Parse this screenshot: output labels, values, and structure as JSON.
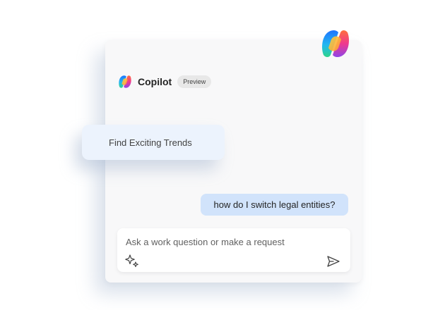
{
  "header": {
    "title": "Copilot",
    "badge": "Preview",
    "logo_icon": "copilot-logo-icon"
  },
  "suggestion": {
    "label": "Find Exciting Trends"
  },
  "conversation": {
    "user_message": "how do I switch legal entities?"
  },
  "composer": {
    "placeholder": "Ask a work question or make a request",
    "value": "",
    "left_icon": "sparkle-icon",
    "right_icon": "send-icon"
  },
  "colors": {
    "panel_bg": "#f8f8f9",
    "user_bubble": "#d1e3fb",
    "suggestion_bg": "#ecf3fd",
    "badge_bg": "#e8e8e8",
    "text_primary": "#242424",
    "text_secondary": "#616161"
  }
}
